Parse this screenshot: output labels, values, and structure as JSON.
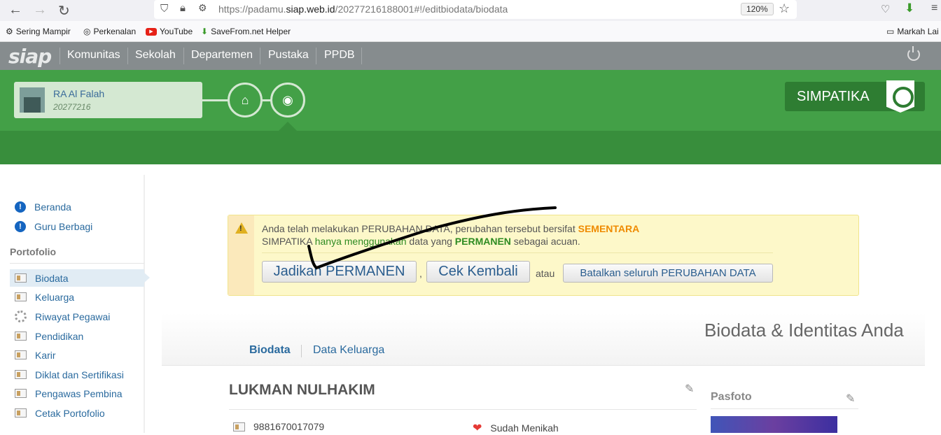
{
  "browser": {
    "url_prefix": "https://padamu.",
    "url_domain": "siap.web.id",
    "url_suffix": "/20277216188001#!/editbiodata/biodata",
    "zoom": "120%",
    "bookmarks": [
      "Sering Mampir",
      "Perkenalan",
      "YouTube",
      "SaveFrom.net Helper"
    ],
    "bookmark_folder": "Markah Lai"
  },
  "topnav": {
    "logo": "siap",
    "items": [
      "Komunitas",
      "Sekolah",
      "Departemen",
      "Pustaka",
      "PPDB"
    ]
  },
  "header": {
    "school_name": "RA Al Falah",
    "school_id": "20277216",
    "brand": "SIMPATIKA"
  },
  "sidebar": {
    "top_items": [
      "Beranda",
      "Guru Berbagi"
    ],
    "section_title": "Portofolio",
    "items": [
      "Biodata",
      "Keluarga",
      "Riwayat Pegawai",
      "Pendidikan",
      "Karir",
      "Diklat dan Sertifikasi",
      "Pengawas Pembina",
      "Cetak Portofolio"
    ]
  },
  "alert": {
    "line1_a": "Anda telah melakukan PERUBAHAN DATA, perubahan tersebut bersifat ",
    "line1_b": "SEMENTARA",
    "line2_a": "SIMPATIKA ",
    "line2_b": "hanya menggunakan",
    "line2_c": " data yang ",
    "line2_d": "PERMANEN",
    "line2_e": " sebagai acuan.",
    "btn_permanen": "Jadikan PERMANEN",
    "comma": ",",
    "btn_cek": "Cek Kembali",
    "atau": "atau",
    "btn_batal": "Batalkan seluruh PERUBAHAN DATA"
  },
  "main": {
    "page_title": "Biodata & Identitas Anda",
    "tabs": [
      "Biodata",
      "Data Keluarga"
    ],
    "person_name": "LUKMAN NULHAKIM",
    "pasfoto_label": "Pasfoto",
    "id_number": "9881670017079",
    "marital_status": "Sudah Menikah"
  },
  "colors": {
    "green": "#43a047",
    "dark_green": "#388e3c",
    "nav_gray": "#868c8e",
    "link_blue": "#2a6a9e",
    "orange": "#ef8a00"
  }
}
